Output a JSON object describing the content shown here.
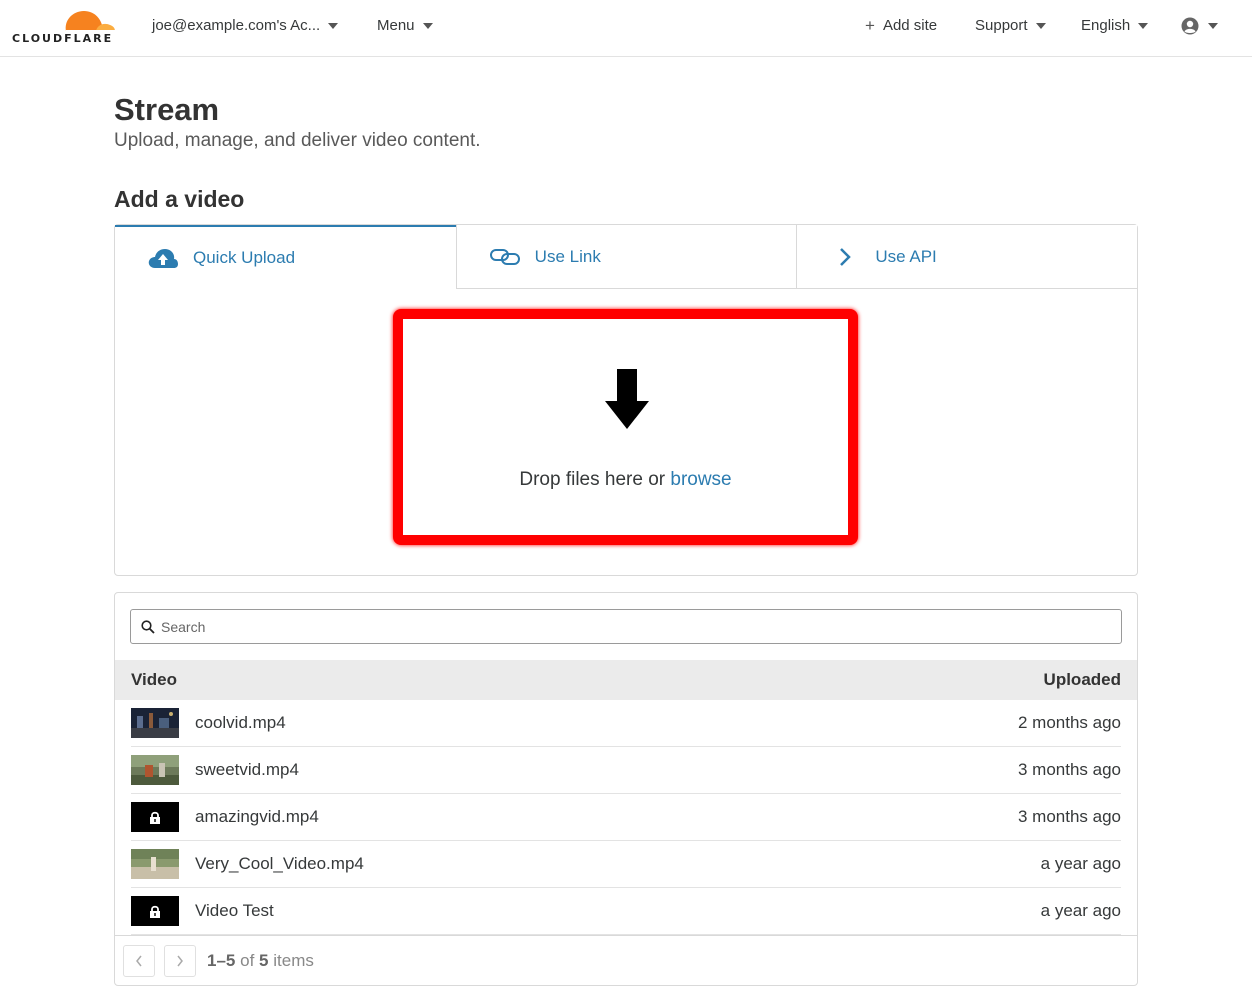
{
  "brand": {
    "logo_text": "CLOUDFLARE",
    "accent": "#f6821f"
  },
  "topnav": {
    "account": "joe@example.com's Ac...",
    "menu": "Menu",
    "add_site": "Add site",
    "support": "Support",
    "language": "English"
  },
  "page": {
    "title": "Stream",
    "subtitle": "Upload, manage, and deliver video content."
  },
  "add_video": {
    "title": "Add a video",
    "tabs": [
      {
        "label": "Quick Upload",
        "icon": "cloud-upload-icon",
        "active": true
      },
      {
        "label": "Use Link",
        "icon": "link-icon",
        "active": false
      },
      {
        "label": "Use API",
        "icon": "chevron-right-icon",
        "active": false
      }
    ],
    "dropzone": {
      "text": "Drop files here or",
      "link": "browse"
    }
  },
  "videos": {
    "search_placeholder": "Search",
    "columns": {
      "video": "Video",
      "uploaded": "Uploaded"
    },
    "rows": [
      {
        "name": "coolvid.mp4",
        "uploaded": "2 months ago",
        "thumb": "night-scene"
      },
      {
        "name": "sweetvid.mp4",
        "uploaded": "3 months ago",
        "thumb": "outdoor-scene"
      },
      {
        "name": "amazingvid.mp4",
        "uploaded": "3 months ago",
        "thumb": "locked"
      },
      {
        "name": "Very_Cool_Video.mp4",
        "uploaded": "a year ago",
        "thumb": "beach-scene"
      },
      {
        "name": "Video Test",
        "uploaded": "a year ago",
        "thumb": "locked"
      }
    ],
    "pagination": {
      "range": "1–5",
      "of": "of",
      "total": "5",
      "unit": "items"
    }
  }
}
